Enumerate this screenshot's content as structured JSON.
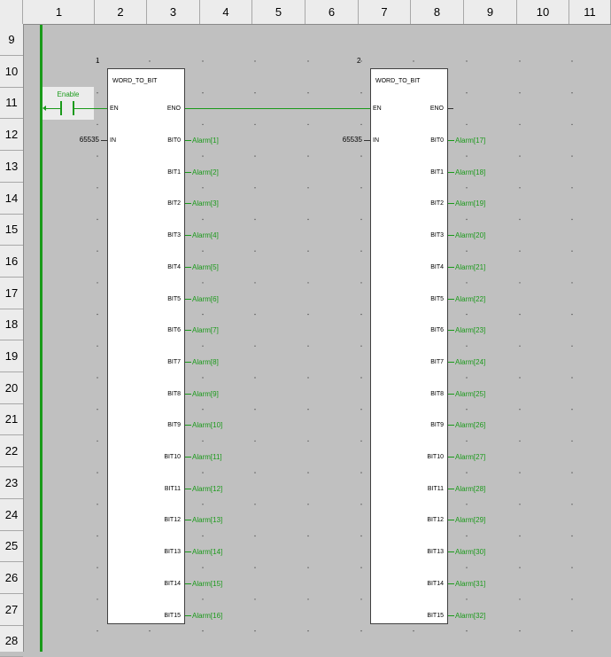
{
  "columns": [
    "1",
    "2",
    "3",
    "4",
    "5",
    "6",
    "7",
    "8",
    "9",
    "10",
    "11"
  ],
  "rows": [
    "9",
    "10",
    "11",
    "12",
    "13",
    "14",
    "15",
    "16",
    "17",
    "18",
    "19",
    "20",
    "21",
    "22",
    "23",
    "24",
    "25",
    "26",
    "27",
    "28"
  ],
  "contact": {
    "label": "Enable"
  },
  "blocks": [
    {
      "number": "1",
      "name": "WORD_TO_BIT",
      "en": "EN",
      "eno": "ENO",
      "in": "IN",
      "in_value": "65535",
      "bits": [
        "BIT0",
        "BIT1",
        "BIT2",
        "BIT3",
        "BIT4",
        "BIT5",
        "BIT6",
        "BIT7",
        "BIT8",
        "BIT9",
        "BIT10",
        "BIT11",
        "BIT12",
        "BIT13",
        "BIT14",
        "BIT15"
      ],
      "outputs": [
        "Alarm[1]",
        "Alarm[2]",
        "Alarm[3]",
        "Alarm[4]",
        "Alarm[5]",
        "Alarm[6]",
        "Alarm[7]",
        "Alarm[8]",
        "Alarm[9]",
        "Alarm[10]",
        "Alarm[11]",
        "Alarm[12]",
        "Alarm[13]",
        "Alarm[14]",
        "Alarm[15]",
        "Alarm[16]"
      ]
    },
    {
      "number": "2",
      "name": "WORD_TO_BIT",
      "en": "EN",
      "eno": "ENO",
      "in": "IN",
      "in_value": "65535",
      "bits": [
        "BIT0",
        "BIT1",
        "BIT2",
        "BIT3",
        "BIT4",
        "BIT5",
        "BIT6",
        "BIT7",
        "BIT8",
        "BIT9",
        "BIT10",
        "BIT11",
        "BIT12",
        "BIT13",
        "BIT14",
        "BIT15"
      ],
      "outputs": [
        "Alarm[17]",
        "Alarm[18]",
        "Alarm[19]",
        "Alarm[20]",
        "Alarm[21]",
        "Alarm[22]",
        "Alarm[23]",
        "Alarm[24]",
        "Alarm[25]",
        "Alarm[26]",
        "Alarm[27]",
        "Alarm[28]",
        "Alarm[29]",
        "Alarm[30]",
        "Alarm[31]",
        "Alarm[32]"
      ]
    }
  ],
  "colors": {
    "wire_active": "#1a9a1a",
    "background": "#c0c0c0",
    "header": "#ececec"
  }
}
